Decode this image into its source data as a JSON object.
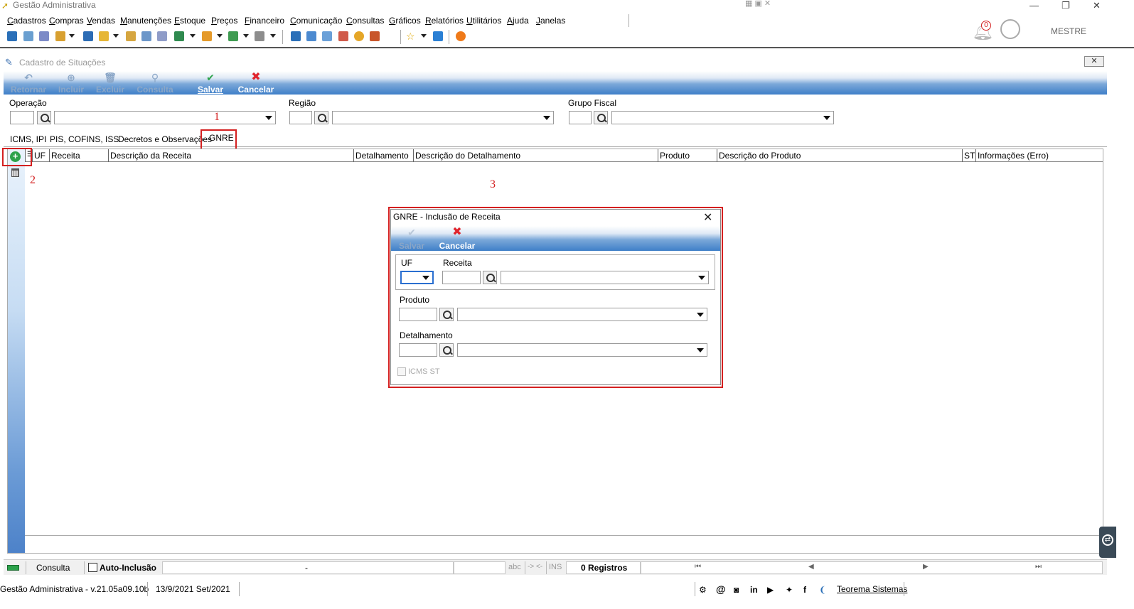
{
  "app_title": "Gestão Administrativa",
  "menu": [
    "Cadastros",
    "Compras",
    "Vendas",
    "Manutenções",
    "Estoque",
    "Preços",
    "Financeiro",
    "Comunicação",
    "Consultas",
    "Gráficos",
    "Relatórios",
    "Utilitários",
    "Ajuda",
    "Janelas"
  ],
  "user": {
    "name": "MESTRE",
    "notifications": "0"
  },
  "form": {
    "title": "Cadastro de Situações",
    "toolbar": {
      "retornar": "Retornar",
      "incluir": "Incluir",
      "excluir": "Excluir",
      "consulta": "Consulta",
      "salvar": "Salvar",
      "cancelar": "Cancelar"
    },
    "fields": {
      "operacao": "Operação",
      "regiao": "Região",
      "grupo_fiscal": "Grupo Fiscal"
    },
    "tabs": [
      "ICMS, IPI",
      "PIS, COFINS, ISS",
      "Decretos e Observações",
      "GNRE"
    ],
    "grid_columns": [
      "UF",
      "Receita",
      "Descrição da Receita",
      "Detalhamento",
      "Descrição do Detalhamento",
      "Produto",
      "Descrição do Produto",
      "ST",
      "Informações (Erro)"
    ]
  },
  "annotations": {
    "n1": "1",
    "n2": "2",
    "n3": "3"
  },
  "dialog": {
    "title": "GNRE - Inclusão de Receita",
    "salvar": "Salvar",
    "cancelar": "Cancelar",
    "uf": "UF",
    "receita": "Receita",
    "produto": "Produto",
    "detalhamento": "Detalhamento",
    "icms_st": "ICMS ST"
  },
  "statusbar": {
    "consulta": "Consulta",
    "auto_inclusao": "Auto-Inclusão",
    "dash": "-",
    "abc": "abc",
    "arrows": "-> <-",
    "ins": "INS",
    "registros": "0 Registros"
  },
  "footer": {
    "version": "Gestão Administrativa - v.21.05a09.10b",
    "date": "13/9/2021 Set/2021",
    "company": "Teorema Sistemas"
  },
  "colors": {
    "accent_blue": "#3f7fc8",
    "annotation_red": "#d42020",
    "add_green": "#2ca24b"
  }
}
